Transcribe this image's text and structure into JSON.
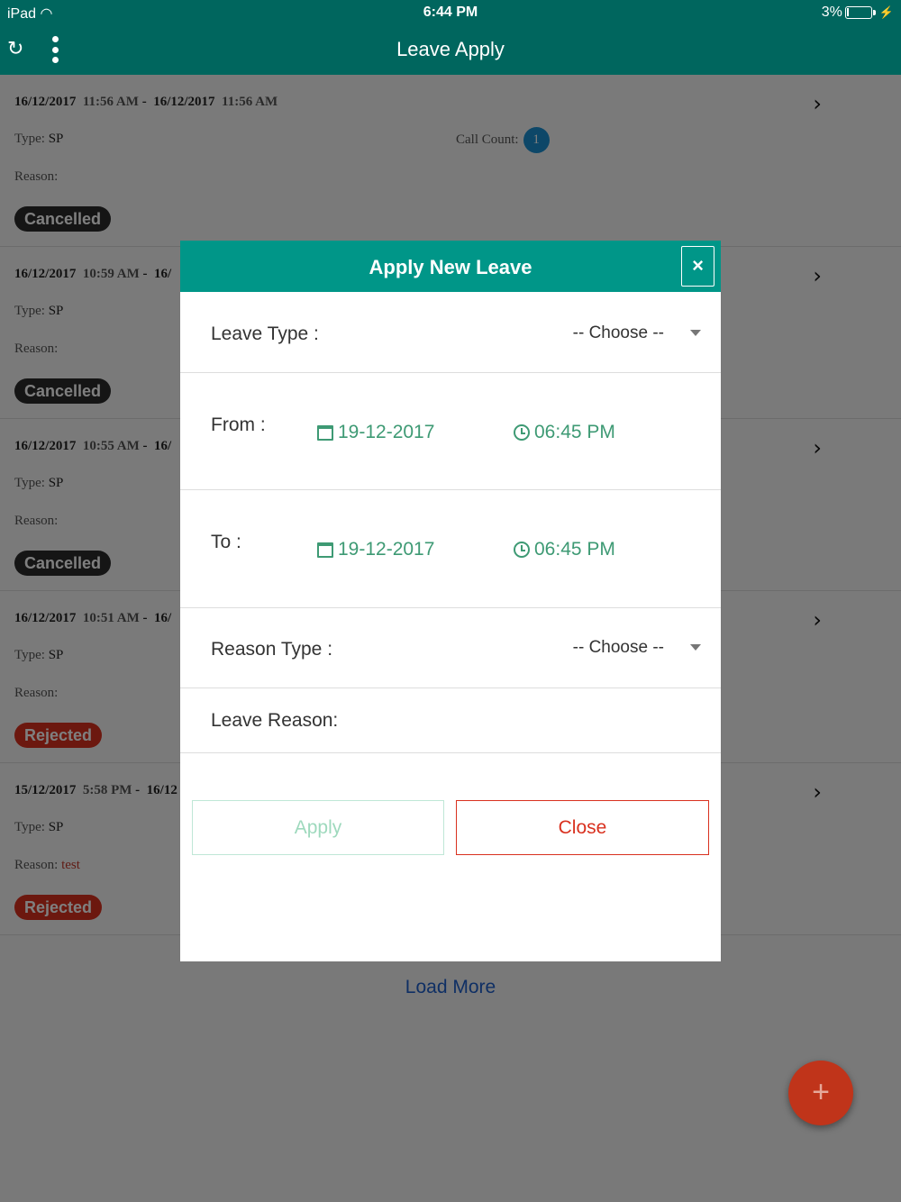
{
  "status_bar": {
    "device": "iPad",
    "time": "6:44 PM",
    "battery_text": "3%",
    "battery_level": 0.03
  },
  "app_bar": {
    "title": "Leave Apply",
    "refresh_icon": "refresh-icon",
    "menu_icon": "kebab-menu-icon"
  },
  "leaves": [
    {
      "from_date": "16/12/2017",
      "from_time": "11:56 AM",
      "to_date": "16/12/2017",
      "to_time": "11:56 AM",
      "type_label": "Type:",
      "type": "SP",
      "reason_label": "Reason:",
      "reason": "",
      "status": "Cancelled",
      "call_count_label": "Call Count:",
      "call_count": "1"
    },
    {
      "from_date": "16/12/2017",
      "from_time": "10:59 AM",
      "to_date": "16/",
      "type_label": "Type:",
      "type": "SP",
      "reason_label": "Reason:",
      "reason": "",
      "status": "Cancelled"
    },
    {
      "from_date": "16/12/2017",
      "from_time": "10:55 AM",
      "to_date": "16/",
      "type_label": "Type:",
      "type": "SP",
      "reason_label": "Reason:",
      "reason": "",
      "status": "Cancelled"
    },
    {
      "from_date": "16/12/2017",
      "from_time": "10:51 AM",
      "to_date": "16/",
      "type_label": "Type:",
      "type": "SP",
      "reason_label": "Reason:",
      "reason": "",
      "status": "Rejected"
    },
    {
      "from_date": "15/12/2017",
      "from_time": "5:58 PM",
      "to_date": "16/12",
      "type_label": "Type:",
      "type": "SP",
      "reason_label": "Reason:",
      "reason": "test",
      "status": "Rejected"
    }
  ],
  "load_more": "Load More",
  "fab": {
    "label": "+"
  },
  "modal": {
    "title": "Apply New Leave",
    "close_icon": "×",
    "leave_type": {
      "label": "Leave Type :",
      "value": "-- Choose --"
    },
    "from": {
      "label": "From :",
      "date": "19-12-2017",
      "time": "06:45 PM"
    },
    "to": {
      "label": "To :",
      "date": "19-12-2017",
      "time": "06:45 PM"
    },
    "reason_type": {
      "label": "Reason Type :",
      "value": "-- Choose --"
    },
    "leave_reason": {
      "label": "Leave Reason:"
    },
    "apply_button": "Apply",
    "close_button": "Close"
  },
  "colors": {
    "header": "#00665e",
    "modal_header": "#009688",
    "accent_green": "#3e9a74",
    "danger": "#d9311f",
    "link": "#1e5ec9"
  }
}
